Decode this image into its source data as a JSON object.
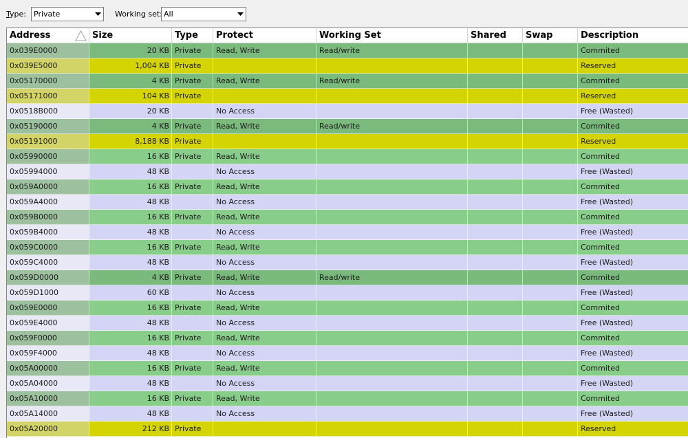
{
  "filters": {
    "type_label_first": "T",
    "type_label_rest": "ype:",
    "type_value": "Private",
    "ws_label": "Working set:",
    "ws_value": "All"
  },
  "columns": [
    "Address",
    "Size",
    "Type",
    "Protect",
    "Working Set",
    "Shared",
    "Swap",
    "Description"
  ],
  "colors": {
    "committed_ws": "#7aba7c",
    "committed": "#88cd8a",
    "reserved": "#d3d401",
    "free": "#d4d4f5",
    "addr_committed": "#9dc09f",
    "addr_reserved": "#d3d468",
    "addr_free": "#e8e8f6"
  },
  "rows": [
    {
      "address": "0x039E0000",
      "size": "20 KB",
      "type": "Private",
      "protect": "Read, Write",
      "ws": "Read/write",
      "shared": "",
      "swap": "",
      "desc": "Commited",
      "kind": "committed_ws"
    },
    {
      "address": "0x039E5000",
      "size": "1,004 KB",
      "type": "Private",
      "protect": "",
      "ws": "",
      "shared": "",
      "swap": "",
      "desc": "Reserved",
      "kind": "reserved"
    },
    {
      "address": "0x05170000",
      "size": "4 KB",
      "type": "Private",
      "protect": "Read, Write",
      "ws": "Read/write",
      "shared": "",
      "swap": "",
      "desc": "Commited",
      "kind": "committed_ws"
    },
    {
      "address": "0x05171000",
      "size": "104 KB",
      "type": "Private",
      "protect": "",
      "ws": "",
      "shared": "",
      "swap": "",
      "desc": "Reserved",
      "kind": "reserved"
    },
    {
      "address": "0x0518B000",
      "size": "20 KB",
      "type": "",
      "protect": "No Access",
      "ws": "",
      "shared": "",
      "swap": "",
      "desc": "Free (Wasted)",
      "kind": "free"
    },
    {
      "address": "0x05190000",
      "size": "4 KB",
      "type": "Private",
      "protect": "Read, Write",
      "ws": "Read/write",
      "shared": "",
      "swap": "",
      "desc": "Commited",
      "kind": "committed_ws"
    },
    {
      "address": "0x05191000",
      "size": "8,188 KB",
      "type": "Private",
      "protect": "",
      "ws": "",
      "shared": "",
      "swap": "",
      "desc": "Reserved",
      "kind": "reserved"
    },
    {
      "address": "0x05990000",
      "size": "16 KB",
      "type": "Private",
      "protect": "Read, Write",
      "ws": "",
      "shared": "",
      "swap": "",
      "desc": "Commited",
      "kind": "committed"
    },
    {
      "address": "0x05994000",
      "size": "48 KB",
      "type": "",
      "protect": "No Access",
      "ws": "",
      "shared": "",
      "swap": "",
      "desc": "Free (Wasted)",
      "kind": "free"
    },
    {
      "address": "0x059A0000",
      "size": "16 KB",
      "type": "Private",
      "protect": "Read, Write",
      "ws": "",
      "shared": "",
      "swap": "",
      "desc": "Commited",
      "kind": "committed"
    },
    {
      "address": "0x059A4000",
      "size": "48 KB",
      "type": "",
      "protect": "No Access",
      "ws": "",
      "shared": "",
      "swap": "",
      "desc": "Free (Wasted)",
      "kind": "free"
    },
    {
      "address": "0x059B0000",
      "size": "16 KB",
      "type": "Private",
      "protect": "Read, Write",
      "ws": "",
      "shared": "",
      "swap": "",
      "desc": "Commited",
      "kind": "committed"
    },
    {
      "address": "0x059B4000",
      "size": "48 KB",
      "type": "",
      "protect": "No Access",
      "ws": "",
      "shared": "",
      "swap": "",
      "desc": "Free (Wasted)",
      "kind": "free"
    },
    {
      "address": "0x059C0000",
      "size": "16 KB",
      "type": "Private",
      "protect": "Read, Write",
      "ws": "",
      "shared": "",
      "swap": "",
      "desc": "Commited",
      "kind": "committed"
    },
    {
      "address": "0x059C4000",
      "size": "48 KB",
      "type": "",
      "protect": "No Access",
      "ws": "",
      "shared": "",
      "swap": "",
      "desc": "Free (Wasted)",
      "kind": "free"
    },
    {
      "address": "0x059D0000",
      "size": "4 KB",
      "type": "Private",
      "protect": "Read, Write",
      "ws": "Read/write",
      "shared": "",
      "swap": "",
      "desc": "Commited",
      "kind": "committed_ws"
    },
    {
      "address": "0x059D1000",
      "size": "60 KB",
      "type": "",
      "protect": "No Access",
      "ws": "",
      "shared": "",
      "swap": "",
      "desc": "Free (Wasted)",
      "kind": "free"
    },
    {
      "address": "0x059E0000",
      "size": "16 KB",
      "type": "Private",
      "protect": "Read, Write",
      "ws": "",
      "shared": "",
      "swap": "",
      "desc": "Commited",
      "kind": "committed"
    },
    {
      "address": "0x059E4000",
      "size": "48 KB",
      "type": "",
      "protect": "No Access",
      "ws": "",
      "shared": "",
      "swap": "",
      "desc": "Free (Wasted)",
      "kind": "free"
    },
    {
      "address": "0x059F0000",
      "size": "16 KB",
      "type": "Private",
      "protect": "Read, Write",
      "ws": "",
      "shared": "",
      "swap": "",
      "desc": "Commited",
      "kind": "committed"
    },
    {
      "address": "0x059F4000",
      "size": "48 KB",
      "type": "",
      "protect": "No Access",
      "ws": "",
      "shared": "",
      "swap": "",
      "desc": "Free (Wasted)",
      "kind": "free"
    },
    {
      "address": "0x05A00000",
      "size": "16 KB",
      "type": "Private",
      "protect": "Read, Write",
      "ws": "",
      "shared": "",
      "swap": "",
      "desc": "Commited",
      "kind": "committed"
    },
    {
      "address": "0x05A04000",
      "size": "48 KB",
      "type": "",
      "protect": "No Access",
      "ws": "",
      "shared": "",
      "swap": "",
      "desc": "Free (Wasted)",
      "kind": "free"
    },
    {
      "address": "0x05A10000",
      "size": "16 KB",
      "type": "Private",
      "protect": "Read, Write",
      "ws": "",
      "shared": "",
      "swap": "",
      "desc": "Commited",
      "kind": "committed"
    },
    {
      "address": "0x05A14000",
      "size": "48 KB",
      "type": "",
      "protect": "No Access",
      "ws": "",
      "shared": "",
      "swap": "",
      "desc": "Free (Wasted)",
      "kind": "free"
    },
    {
      "address": "0x05A20000",
      "size": "212 KB",
      "type": "Private",
      "protect": "",
      "ws": "",
      "shared": "",
      "swap": "",
      "desc": "Reserved",
      "kind": "reserved"
    }
  ]
}
